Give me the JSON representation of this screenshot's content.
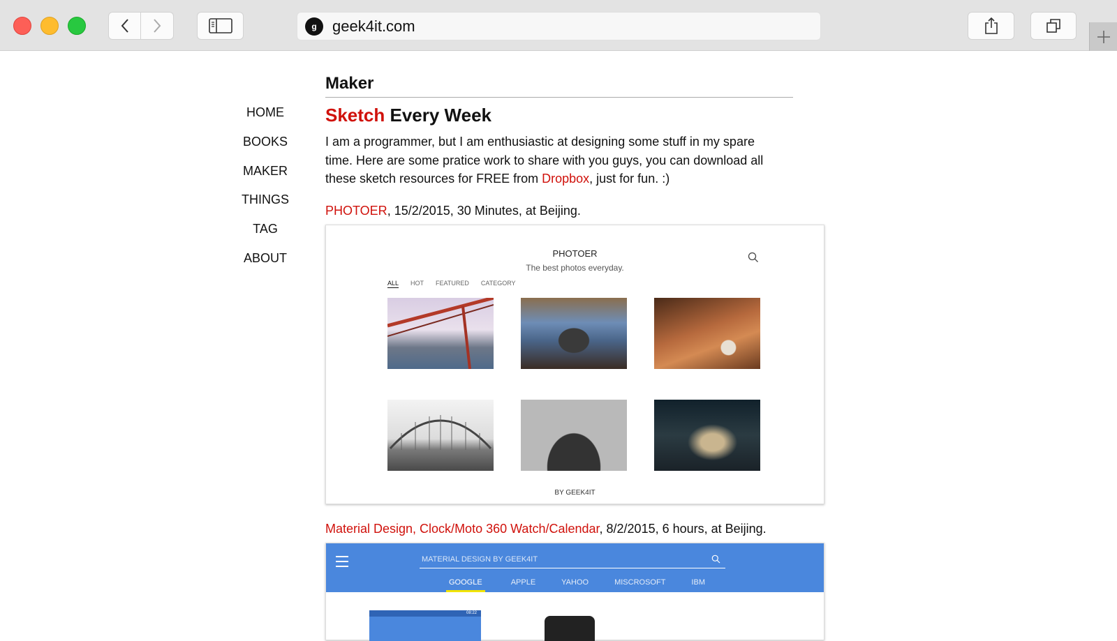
{
  "browser": {
    "url": "geek4it.com",
    "favicon_text": "g"
  },
  "nav": {
    "items": [
      "HOME",
      "BOOKS",
      "MAKER",
      "THINGS",
      "TAG",
      "ABOUT"
    ]
  },
  "main": {
    "page_title": "Maker",
    "headline_accent": "Sketch",
    "headline_rest": " Every Week",
    "intro_before": "I am a programmer, but I am enthusiastic at designing some stuff in my spare time. Here are some pratice work to share with you guys, you can download all these sketch resources for FREE from ",
    "intro_link": "Dropbox",
    "intro_after": ", just for fun. :)",
    "entries": [
      {
        "link": "PHOTOER",
        "meta": ", 15/2/2015, 30 Minutes, at Beijing.",
        "preview": {
          "title": "PHOTOER",
          "subtitle": "The best photos everyday.",
          "tabs": [
            "ALL",
            "HOT",
            "FEATURED",
            "CATEGORY"
          ],
          "active_tab": "ALL",
          "footer": "BY GEEK4IT"
        }
      },
      {
        "link": "Material Design, Clock/Moto 360 Watch/Calendar",
        "meta": ", 8/2/2015, 6 hours, at Beijing.",
        "preview": {
          "search_placeholder": "MATERIAL DESIGN BY GEEK4IT",
          "tabs": [
            "GOOGLE",
            "APPLE",
            "YAHOO",
            "MISCROSOFT",
            "IBM"
          ],
          "active_tab": "GOOGLE",
          "status_time": "08:22"
        }
      }
    ]
  },
  "colors": {
    "accent_red": "#d0110b",
    "material_blue": "#4a87dd",
    "tab_indicator": "#f2e400"
  }
}
